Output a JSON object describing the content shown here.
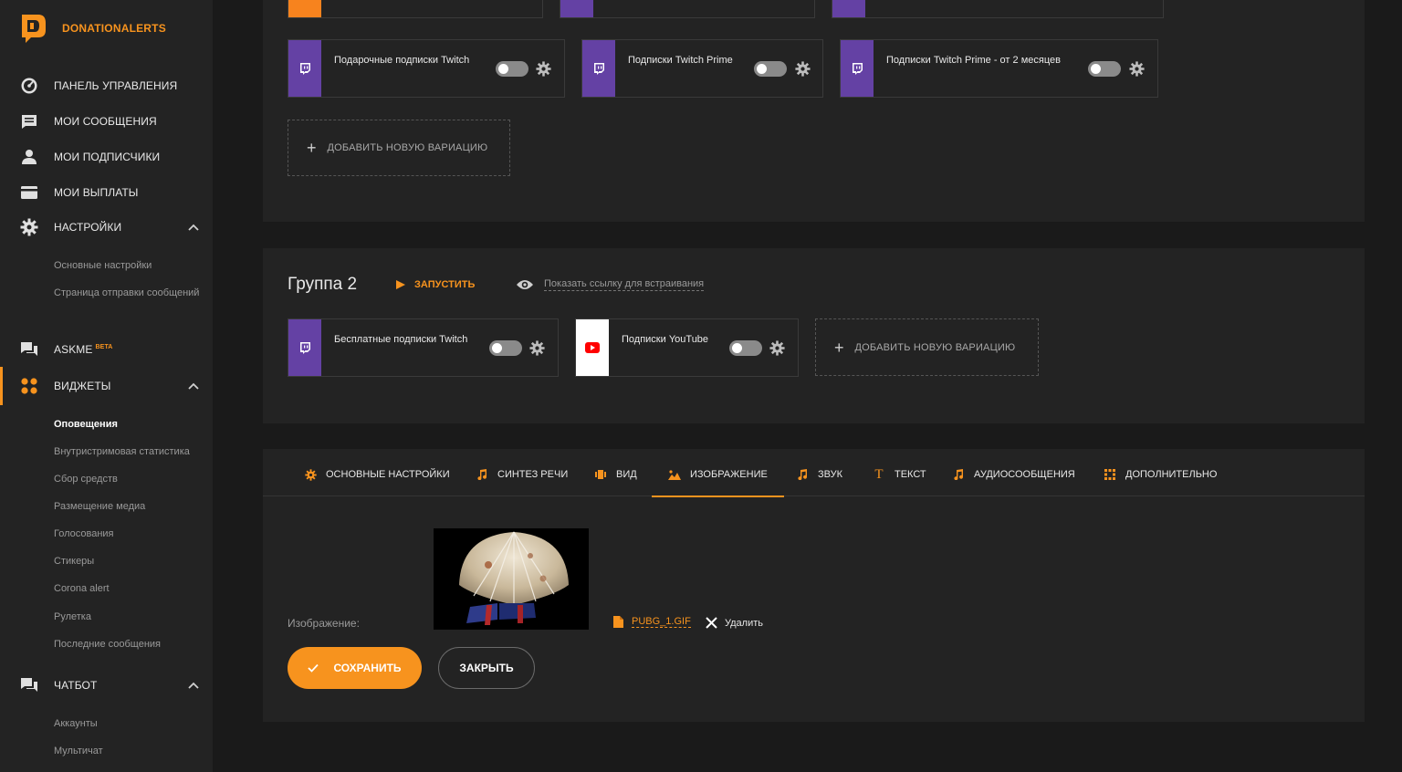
{
  "brand": {
    "name": "DONATIONALERTS",
    "accent": "#f7931e",
    "twitch_color": "#6441a4",
    "youtube_color": "#ff0000"
  },
  "sidebar": {
    "items": [
      {
        "label": "ПАНЕЛЬ УПРАВЛЕНИЯ",
        "icon": "dashboard-icon"
      },
      {
        "label": "МОИ СООБЩЕНИЯ",
        "icon": "messages-icon"
      },
      {
        "label": "МОИ ПОДПИСЧИКИ",
        "icon": "user-icon"
      },
      {
        "label": "МОИ ВЫПЛАТЫ",
        "icon": "card-icon"
      },
      {
        "label": "НАСТРОЙКИ",
        "icon": "gear-icon"
      },
      {
        "label": "ASKME",
        "badge": "BETA",
        "icon": "chat-icon"
      },
      {
        "label": "ВИДЖЕТЫ",
        "icon": "widgets-icon"
      },
      {
        "label": "ЧАТБОТ",
        "icon": "chat-icon"
      }
    ],
    "settings_sub": [
      "Основные настройки",
      "Страница отправки сообщений"
    ],
    "widgets_sub": [
      "Оповещения",
      "Внутристримовая статистика",
      "Сбор средств",
      "Размещение медиа",
      "Голосования",
      "Стикеры",
      "Corona alert",
      "Рулетка",
      "Последние сообщения"
    ],
    "chatbot_sub": [
      "Аккаунты",
      "Мультичат"
    ]
  },
  "group1": {
    "cards": [
      {
        "title": "Подарочные подписки Twitch"
      },
      {
        "title": "Подписки Twitch Prime"
      },
      {
        "title": "Подписки Twitch Prime - от 2 месяцев"
      }
    ],
    "add_label": "ДОБАВИТЬ НОВУЮ ВАРИАЦИЮ"
  },
  "group2": {
    "title": "Группа 2",
    "launch_label": "ЗАПУСТИТЬ",
    "embed_label": "Показать ссылку для встраивания",
    "cards": [
      {
        "title": "Бесплатные подписки Twitch"
      },
      {
        "title": "Подписки YouTube"
      }
    ],
    "add_label": "ДОБАВИТЬ НОВУЮ ВАРИАЦИЮ"
  },
  "tabs": [
    {
      "label": "ОСНОВНЫЕ НАСТРОЙКИ",
      "icon": "gear-icon"
    },
    {
      "label": "СИНТЕЗ РЕЧИ",
      "icon": "music-note-icon"
    },
    {
      "label": "ВИД",
      "icon": "view-icon"
    },
    {
      "label": "ИЗОБРАЖЕНИЕ",
      "icon": "image-icon",
      "active": true
    },
    {
      "label": "ЗВУК",
      "icon": "music-note-icon"
    },
    {
      "label": "ТЕКСТ",
      "icon": "text-icon"
    },
    {
      "label": "АУДИОСООБЩЕНИЯ",
      "icon": "music-note-icon"
    },
    {
      "label": "ДОПОЛНИТЕЛЬНО",
      "icon": "extra-icon"
    }
  ],
  "image_section": {
    "label": "Изображение:",
    "file_name": "PUBG_1.GIF",
    "delete_label": "Удалить"
  },
  "actions": {
    "save_label": "СОХРАНИТЬ",
    "close_label": "ЗАКРЫТЬ"
  }
}
